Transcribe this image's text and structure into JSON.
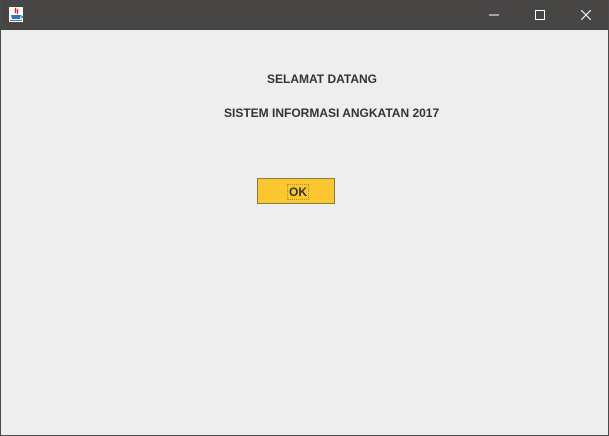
{
  "window": {
    "title": "",
    "icon": "java-app-icon",
    "controls": {
      "minimize_icon": "minimize-icon",
      "maximize_icon": "maximize-icon",
      "close_icon": "close-icon"
    },
    "titlebar_color": "#484644"
  },
  "content": {
    "welcome_text": "SELAMAT DATANG",
    "system_text": "SISTEM INFORMASI ANGKATAN 2017",
    "ok_button_label": "OK",
    "ok_button_color": "#fbc731",
    "background_color": "#eeeeee"
  }
}
